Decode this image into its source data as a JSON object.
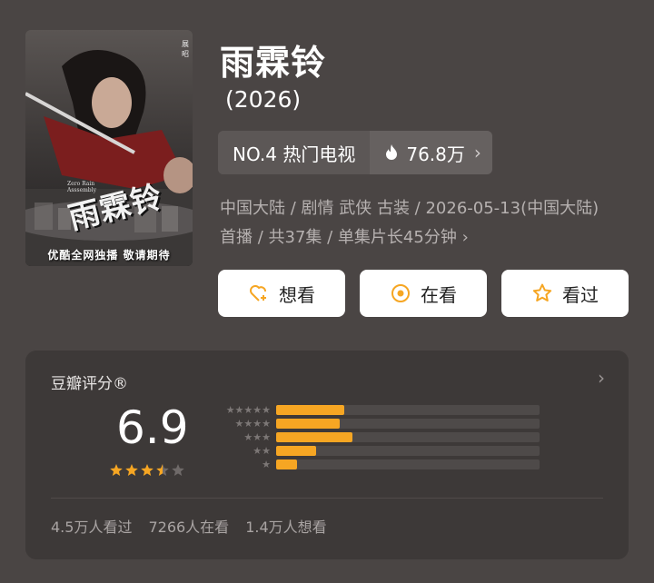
{
  "poster": {
    "title_art": "雨霖铃",
    "subtitle_art": "Zero Rain Asssembly",
    "actor_tag": "展昭",
    "footer_text": "优酷全网独播 敬请期待"
  },
  "title": "雨霖铃",
  "year": "(2026)",
  "rank": {
    "label": "NO.4 热门电视",
    "heat": "76.8万",
    "chevron": "›"
  },
  "meta": {
    "line": "中国大陆 / 剧情 武侠 古装 / 2026-05-13(中国大陆) 首播 / 共37集 / 单集片长45分钟",
    "chevron": "›"
  },
  "actions": {
    "want_label": "想看",
    "watching_label": "在看",
    "watched_label": "看过"
  },
  "rating": {
    "card_title": "豆瓣评分®",
    "chevron": "›",
    "score": "6.9",
    "stars_value": 3.5,
    "stars_max": 5,
    "distribution": [
      {
        "stars": 5,
        "fraction": 0.26
      },
      {
        "stars": 4,
        "fraction": 0.24
      },
      {
        "stars": 3,
        "fraction": 0.29
      },
      {
        "stars": 2,
        "fraction": 0.15
      },
      {
        "stars": 1,
        "fraction": 0.08
      }
    ],
    "stats": {
      "watched": "4.5万人看过",
      "watching": "7266人在看",
      "want": "1.4万人想看"
    }
  },
  "colors": {
    "background": "#4a4544",
    "accent": "#f6a623",
    "card": "#3d3938"
  }
}
